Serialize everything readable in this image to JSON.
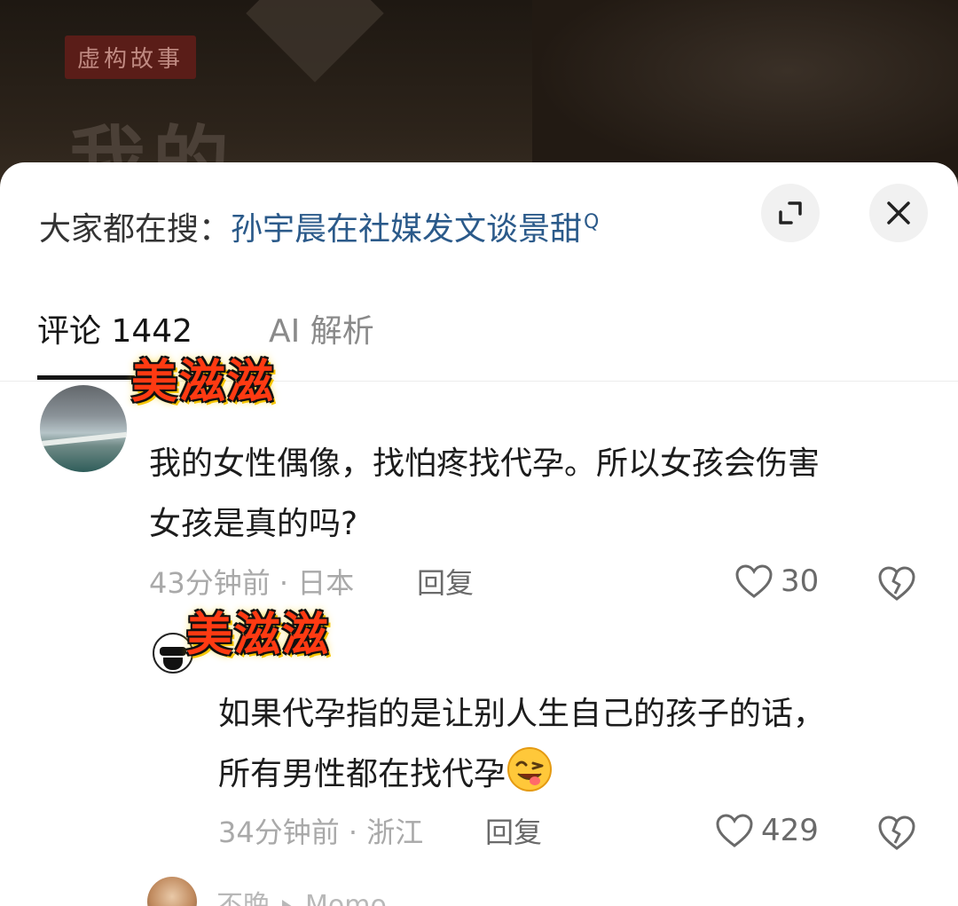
{
  "background": {
    "fiction_tag": "虚构故事",
    "title_fragment": "我的"
  },
  "search_bar": {
    "prefix": "大家都在搜：",
    "term": "孙宇晨在社媒发文谈景甜",
    "search_glyph": "Q"
  },
  "buttons": {
    "expand_icon": "expand-icon",
    "close_icon": "close-icon"
  },
  "tabs": [
    {
      "label": "评论 1442",
      "active": true
    },
    {
      "label": "AI 解析",
      "active": false
    }
  ],
  "watermark": "美滋滋",
  "comments": [
    {
      "text_line1": "我的女性偶像，找怕疼找代孕。所以女孩会伤害",
      "text_line2": "女孩是真的吗?",
      "meta": "43分钟前 · 日本",
      "reply_label": "回复",
      "likes": "30"
    },
    {
      "text_line1": "如果代孕指的是让别人生自己的孩子的话，",
      "text_line2": "所有男性都在找代孕",
      "emoji": "winking-tongue-emoji",
      "meta": "34分钟前 · 浙江",
      "reply_label": "回复",
      "likes": "429"
    }
  ],
  "third_comment": {
    "user": "不晚",
    "reply_to": "Momo"
  },
  "colors": {
    "search_term": "#2b5a8a",
    "watermark": "#ff3a12"
  }
}
